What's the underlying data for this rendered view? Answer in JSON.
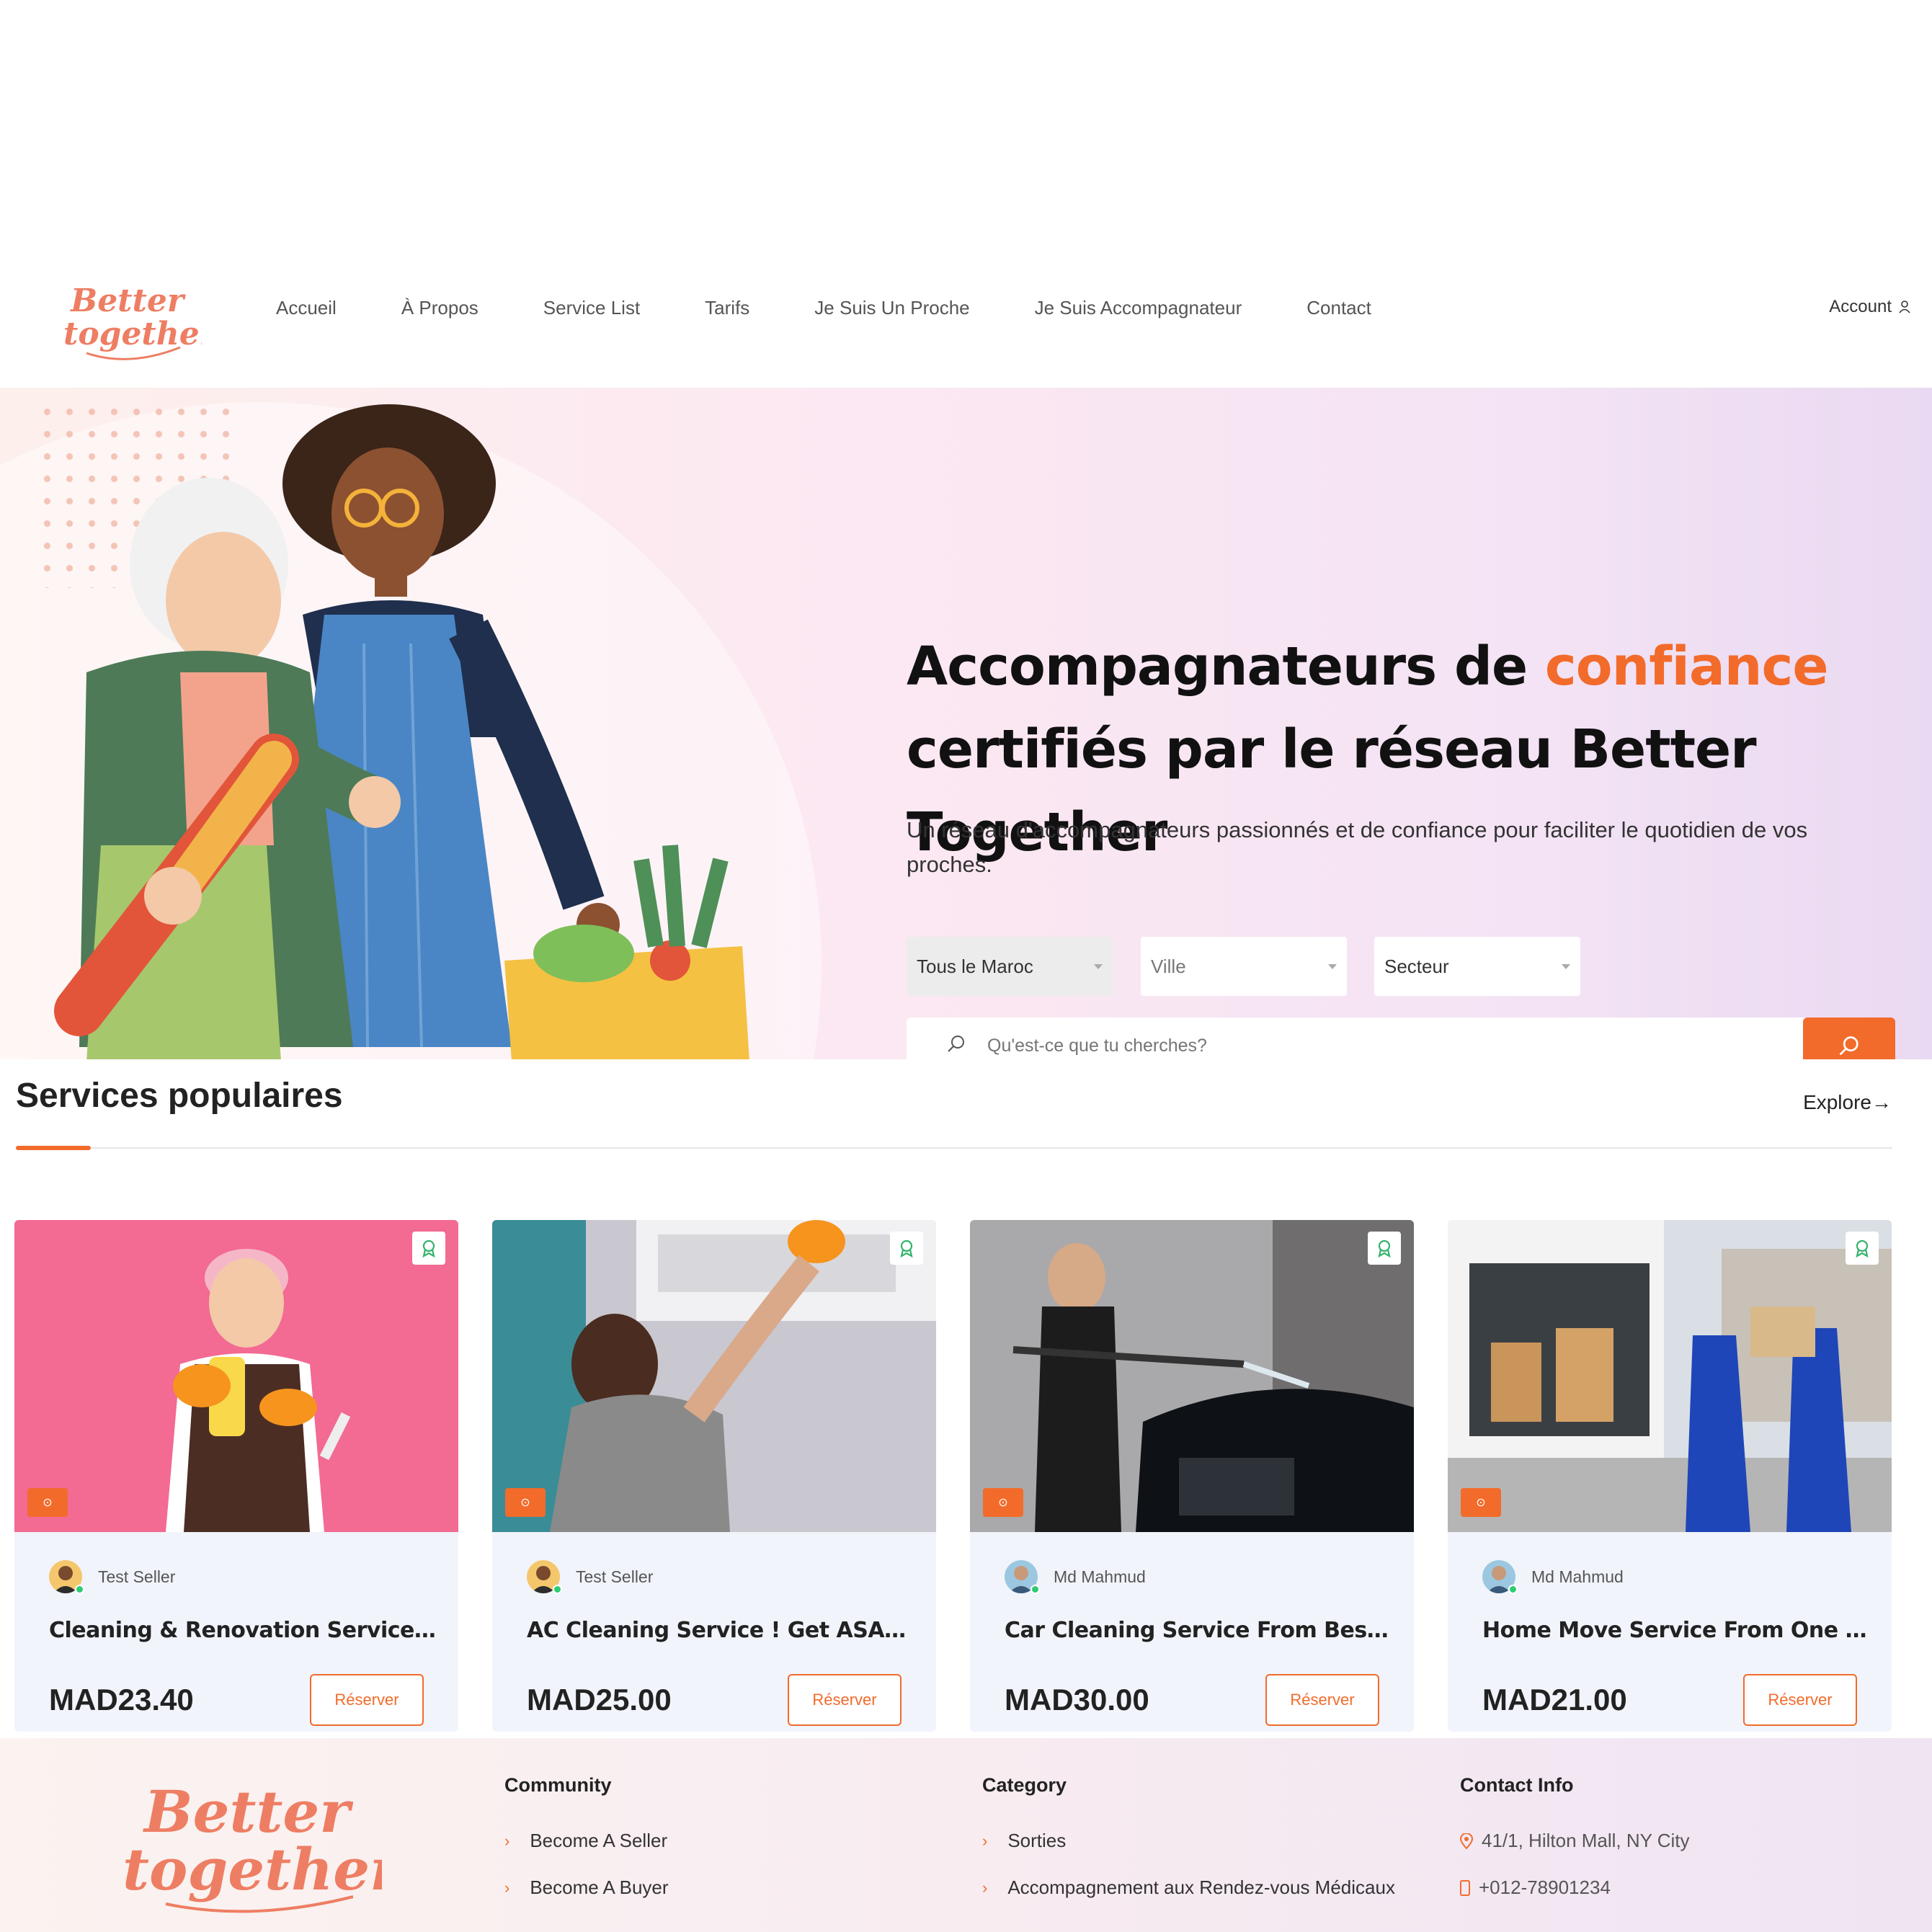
{
  "brand": {
    "logo_line1": "Better",
    "logo_line2": "together",
    "accent": "#f26b2b"
  },
  "nav": {
    "items": [
      "Accueil",
      "À Propos",
      "Service List",
      "Tarifs",
      "Je Suis Un Proche",
      "Je Suis Accompagnateur",
      "Contact"
    ],
    "account_label": "Account"
  },
  "hero": {
    "title_part1": "Accompagnateurs de ",
    "title_accent": "confiance",
    "title_part2": "certifiés par le réseau Better Together",
    "subtitle": "Un réseau d'accompagnateurs passionnés et de confiance pour faciliter le quotidien de vos proches.",
    "select_region": "Tous le Maroc",
    "select_city": "Ville",
    "select_sector": "Secteur",
    "search_placeholder": "Qu'est-ce que tu cherches?"
  },
  "popular": {
    "title": "Services populaires",
    "explore_label": "Explore",
    "cards": [
      {
        "seller": "Test Seller",
        "title": "Cleaning & Renovation Service By...",
        "price": "MAD23.40",
        "button": "Réserver"
      },
      {
        "seller": "Test Seller",
        "title": "AC Cleaning Service ! Get ASAP An...",
        "price": "MAD25.00",
        "button": "Réserver"
      },
      {
        "seller": "Md Mahmud",
        "title": "Car Cleaning Service From Best...",
        "price": "MAD30.00",
        "button": "Réserver"
      },
      {
        "seller": "Md Mahmud",
        "title": "Home Move Service From One City...",
        "price": "MAD21.00",
        "button": "Réserver"
      }
    ]
  },
  "footer": {
    "community": {
      "title": "Community",
      "links": [
        "Become A Seller",
        "Become A Buyer"
      ]
    },
    "category": {
      "title": "Category",
      "links": [
        "Sorties",
        "Accompagnement aux Rendez-vous Médicaux"
      ]
    },
    "contact": {
      "title": "Contact Info",
      "address": "41/1, Hilton Mall, NY City",
      "phone": "+012-78901234"
    }
  }
}
